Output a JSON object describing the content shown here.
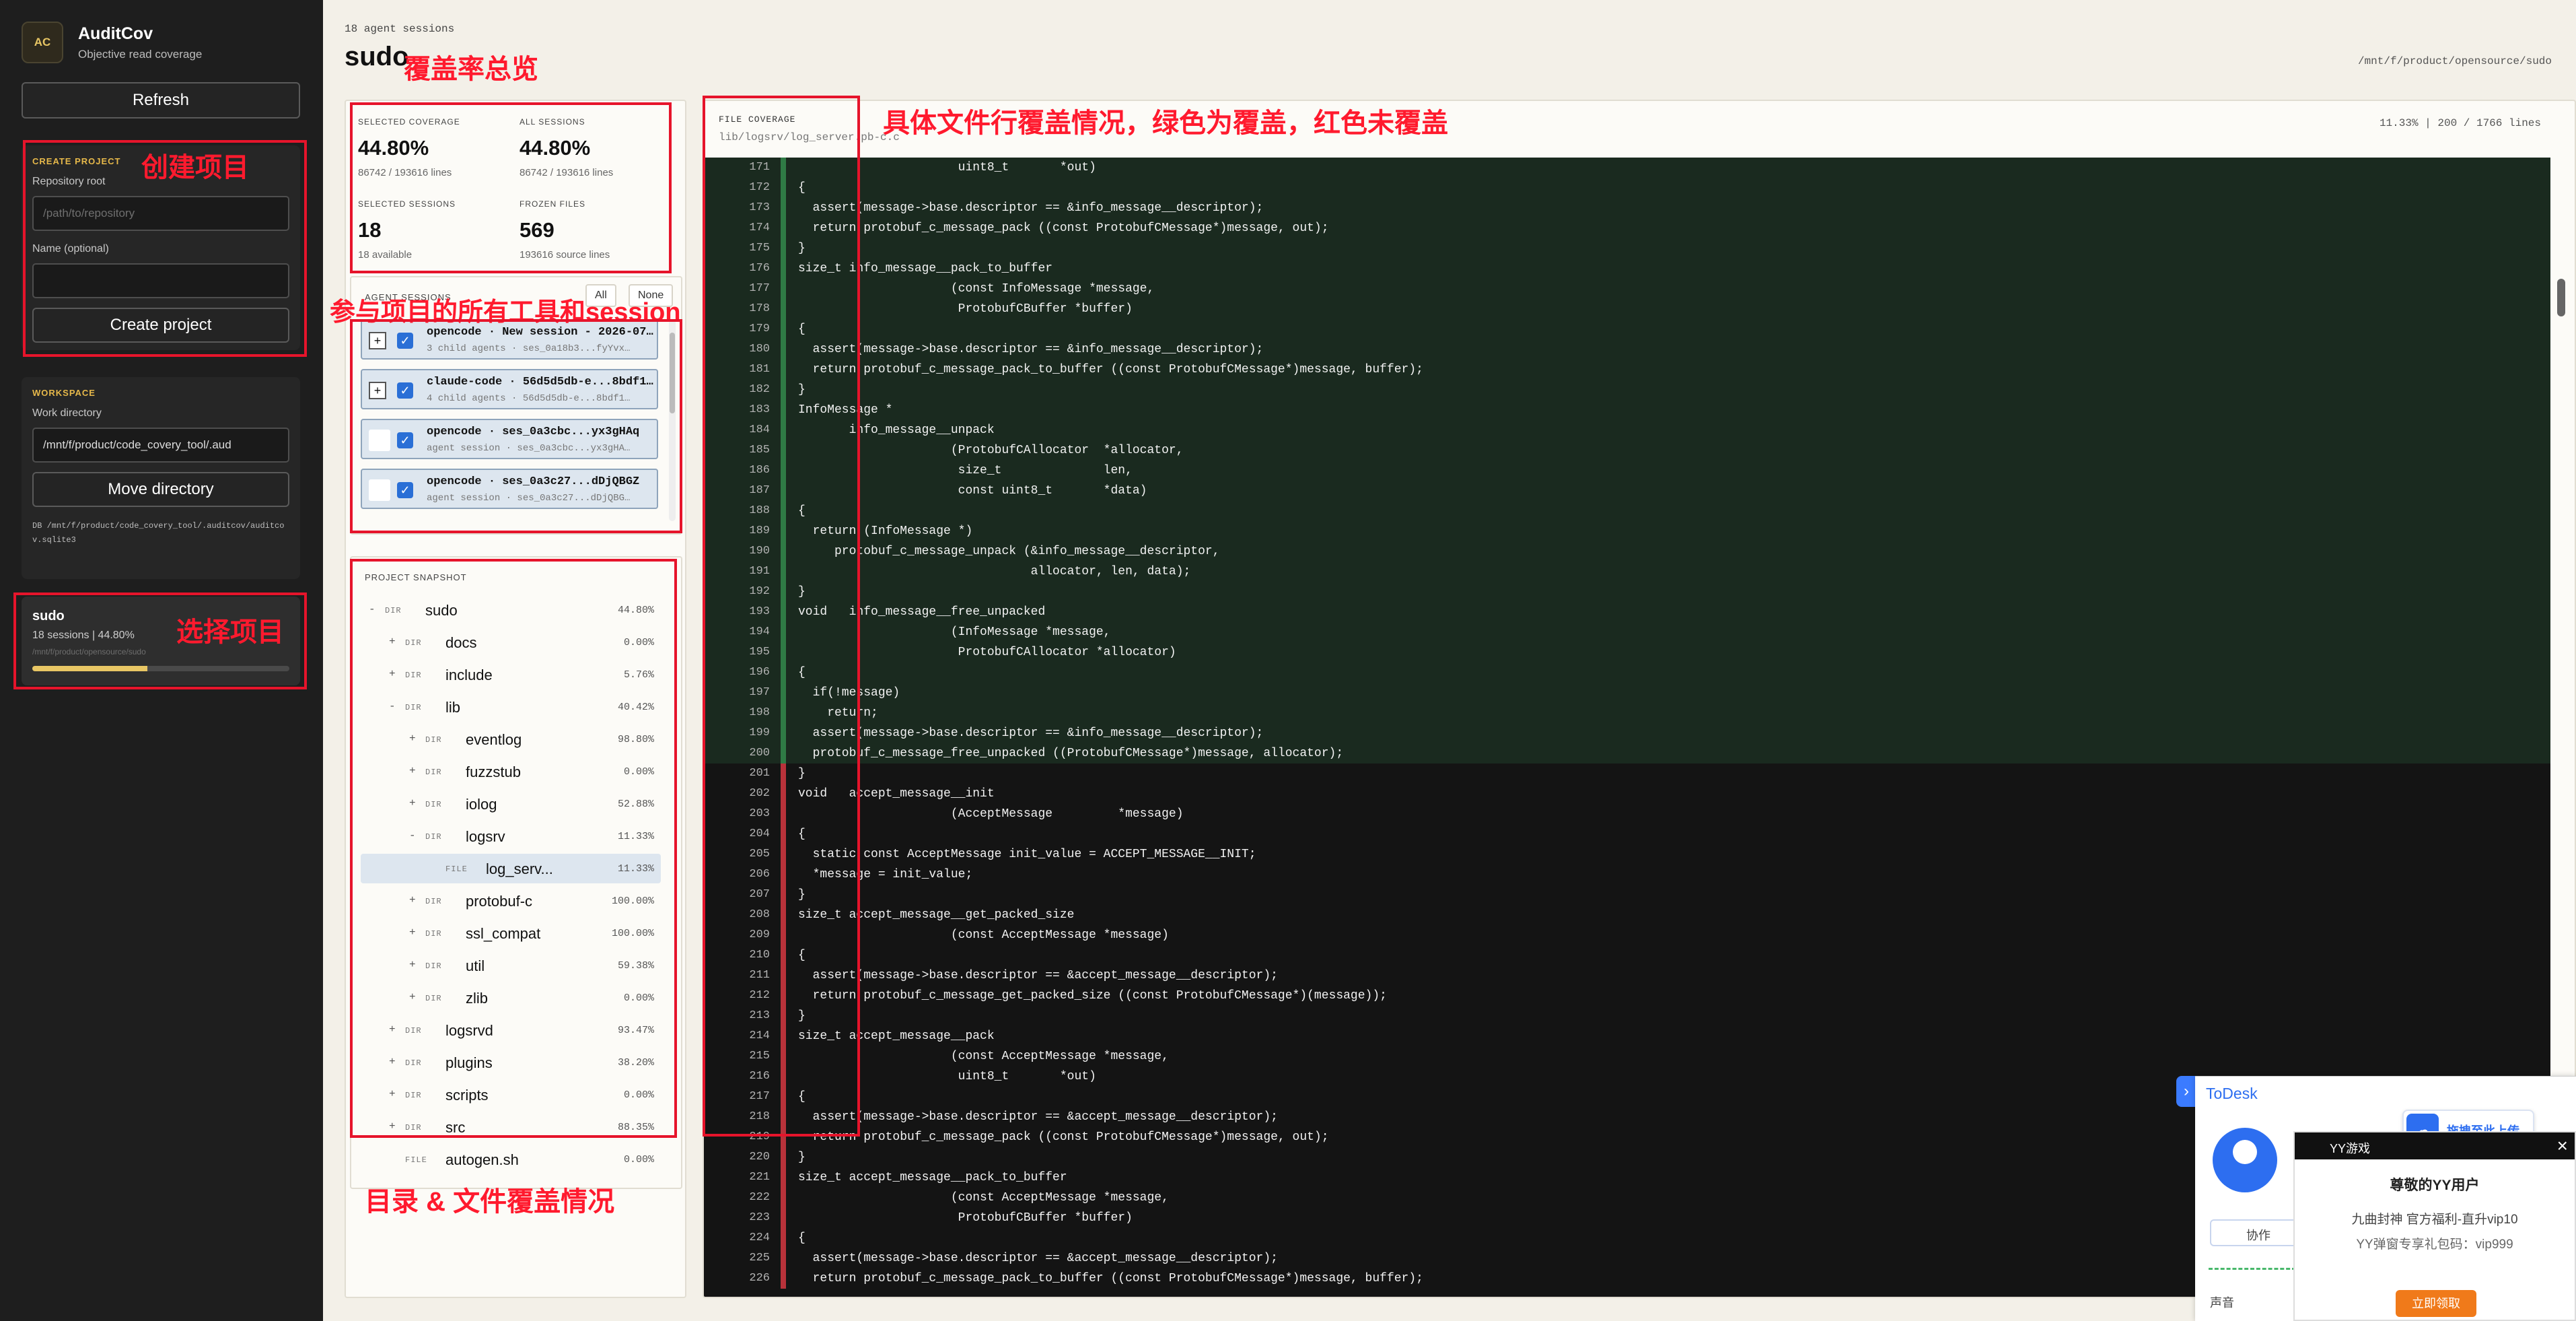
{
  "app": {
    "logo": "AC",
    "name": "AuditCov",
    "subtitle": "Objective read coverage",
    "refresh_label": "Refresh"
  },
  "create_project": {
    "heading": "CREATE PROJECT",
    "repo_label": "Repository root",
    "repo_placeholder": "/path/to/repository",
    "name_label": "Name (optional)",
    "name_value": "",
    "button": "Create project"
  },
  "workspace": {
    "heading": "WORKSPACE",
    "dir_label": "Work directory",
    "dir_value": "/mnt/f/product/code_covery_tool/.aud",
    "button": "Move directory",
    "db_text": "DB /mnt/f/product/code_covery_tool/.auditcov/auditcov.sqlite3"
  },
  "project_item": {
    "name": "sudo",
    "meta": "18 sessions | 44.80%",
    "path": "/mnt/f/product/opensource/sudo",
    "coverage_fraction": 0.448
  },
  "header": {
    "crumb": "18 agent sessions",
    "title": "sudo",
    "path": "/mnt/f/product/opensource/sudo"
  },
  "stats": [
    {
      "label": "SELECTED COVERAGE",
      "value": "44.80%",
      "sub": "86742 / 193616 lines"
    },
    {
      "label": "ALL SESSIONS",
      "value": "44.80%",
      "sub": "86742 / 193616 lines"
    },
    {
      "label": "SELECTED SESSIONS",
      "value": "18",
      "sub": "18 available"
    },
    {
      "label": "FROZEN FILES",
      "value": "569",
      "sub": "193616 source lines"
    }
  ],
  "sessions": {
    "heading": "AGENT SESSIONS",
    "all_label": "All",
    "none_label": "None",
    "items": [
      {
        "expand": "+",
        "title": "opencode · New session - 2026-07…",
        "sub": "3 child agents · ses_0a18b3...fyYvx…"
      },
      {
        "expand": "+",
        "title": "claude-code · 56d5d5db-e...8bdf1…",
        "sub": "4 child agents · 56d5d5db-e...8bdf1…"
      },
      {
        "expand": "",
        "title": "opencode · ses_0a3cbc...yx3gHAq",
        "sub": "agent session · ses_0a3cbc...yx3gHA…"
      },
      {
        "expand": "",
        "title": "opencode · ses_0a3c27...dDjQBGZ",
        "sub": "agent session · ses_0a3c27...dDjQBG…"
      }
    ],
    "check_mark": "✓"
  },
  "snapshot": {
    "heading": "PROJECT SNAPSHOT",
    "rows": [
      {
        "toggle": "-",
        "kind": "DIR",
        "name": "sudo",
        "pct": "44.80%",
        "depth": 0,
        "selected": false
      },
      {
        "toggle": "+",
        "kind": "DIR",
        "name": "docs",
        "pct": "0.00%",
        "depth": 1,
        "selected": false
      },
      {
        "toggle": "+",
        "kind": "DIR",
        "name": "include",
        "pct": "5.76%",
        "depth": 1,
        "selected": false
      },
      {
        "toggle": "-",
        "kind": "DIR",
        "name": "lib",
        "pct": "40.42%",
        "depth": 1,
        "selected": false
      },
      {
        "toggle": "+",
        "kind": "DIR",
        "name": "eventlog",
        "pct": "98.80%",
        "depth": 2,
        "selected": false
      },
      {
        "toggle": "+",
        "kind": "DIR",
        "name": "fuzzstub",
        "pct": "0.00%",
        "depth": 2,
        "selected": false
      },
      {
        "toggle": "+",
        "kind": "DIR",
        "name": "iolog",
        "pct": "52.88%",
        "depth": 2,
        "selected": false
      },
      {
        "toggle": "-",
        "kind": "DIR",
        "name": "logsrv",
        "pct": "11.33%",
        "depth": 2,
        "selected": false
      },
      {
        "toggle": "",
        "kind": "FILE",
        "name": "log_serv...",
        "pct": "11.33%",
        "depth": 3,
        "selected": true
      },
      {
        "toggle": "+",
        "kind": "DIR",
        "name": "protobuf-c",
        "pct": "100.00%",
        "depth": 2,
        "selected": false
      },
      {
        "toggle": "+",
        "kind": "DIR",
        "name": "ssl_compat",
        "pct": "100.00%",
        "depth": 2,
        "selected": false
      },
      {
        "toggle": "+",
        "kind": "DIR",
        "name": "util",
        "pct": "59.38%",
        "depth": 2,
        "selected": false
      },
      {
        "toggle": "+",
        "kind": "DIR",
        "name": "zlib",
        "pct": "0.00%",
        "depth": 2,
        "selected": false
      },
      {
        "toggle": "+",
        "kind": "DIR",
        "name": "logsrvd",
        "pct": "93.47%",
        "depth": 1,
        "selected": false
      },
      {
        "toggle": "+",
        "kind": "DIR",
        "name": "plugins",
        "pct": "38.20%",
        "depth": 1,
        "selected": false
      },
      {
        "toggle": "+",
        "kind": "DIR",
        "name": "scripts",
        "pct": "0.00%",
        "depth": 1,
        "selected": false
      },
      {
        "toggle": "+",
        "kind": "DIR",
        "name": "src",
        "pct": "88.35%",
        "depth": 1,
        "selected": false
      },
      {
        "toggle": "",
        "kind": "FILE",
        "name": "autogen.sh",
        "pct": "0.00%",
        "depth": 1,
        "selected": false
      }
    ]
  },
  "file_coverage": {
    "heading": "FILE COVERAGE",
    "file": "lib/logsrv/log_server.pb-c.c",
    "meta": "11.33% | 200 / 1766 lines",
    "lines": [
      {
        "n": "171",
        "s": "c",
        "t": "                      uint8_t       *out)"
      },
      {
        "n": "172",
        "s": "c",
        "t": "{"
      },
      {
        "n": "173",
        "s": "c",
        "t": "  assert(message->base.descriptor == &info_message__descriptor);"
      },
      {
        "n": "174",
        "s": "c",
        "t": "  return protobuf_c_message_pack ((const ProtobufCMessage*)message, out);"
      },
      {
        "n": "175",
        "s": "c",
        "t": "}"
      },
      {
        "n": "176",
        "s": "c",
        "t": "size_t info_message__pack_to_buffer"
      },
      {
        "n": "177",
        "s": "c",
        "t": "                     (const InfoMessage *message,"
      },
      {
        "n": "178",
        "s": "c",
        "t": "                      ProtobufCBuffer *buffer)"
      },
      {
        "n": "179",
        "s": "c",
        "t": "{"
      },
      {
        "n": "180",
        "s": "c",
        "t": "  assert(message->base.descriptor == &info_message__descriptor);"
      },
      {
        "n": "181",
        "s": "c",
        "t": "  return protobuf_c_message_pack_to_buffer ((const ProtobufCMessage*)message, buffer);"
      },
      {
        "n": "182",
        "s": "c",
        "t": "}"
      },
      {
        "n": "183",
        "s": "c",
        "t": "InfoMessage *"
      },
      {
        "n": "184",
        "s": "c",
        "t": "       info_message__unpack"
      },
      {
        "n": "185",
        "s": "c",
        "t": "                     (ProtobufCAllocator  *allocator,"
      },
      {
        "n": "186",
        "s": "c",
        "t": "                      size_t              len,"
      },
      {
        "n": "187",
        "s": "c",
        "t": "                      const uint8_t       *data)"
      },
      {
        "n": "188",
        "s": "c",
        "t": "{"
      },
      {
        "n": "189",
        "s": "c",
        "t": "  return (InfoMessage *)"
      },
      {
        "n": "190",
        "s": "c",
        "t": "     protobuf_c_message_unpack (&info_message__descriptor,"
      },
      {
        "n": "191",
        "s": "c",
        "t": "                                allocator, len, data);"
      },
      {
        "n": "192",
        "s": "c",
        "t": "}"
      },
      {
        "n": "193",
        "s": "c",
        "t": "void   info_message__free_unpacked"
      },
      {
        "n": "194",
        "s": "c",
        "t": "                     (InfoMessage *message,"
      },
      {
        "n": "195",
        "s": "c",
        "t": "                      ProtobufCAllocator *allocator)"
      },
      {
        "n": "196",
        "s": "c",
        "t": "{"
      },
      {
        "n": "197",
        "s": "c",
        "t": "  if(!message)"
      },
      {
        "n": "198",
        "s": "c",
        "t": "    return;"
      },
      {
        "n": "199",
        "s": "c",
        "t": "  assert(message->base.descriptor == &info_message__descriptor);"
      },
      {
        "n": "200",
        "s": "c",
        "t": "  protobuf_c_message_free_unpacked ((ProtobufCMessage*)message, allocator);"
      },
      {
        "n": "201",
        "s": "u",
        "t": "}"
      },
      {
        "n": "202",
        "s": "u",
        "t": "void   accept_message__init"
      },
      {
        "n": "203",
        "s": "u",
        "t": "                     (AcceptMessage         *message)"
      },
      {
        "n": "204",
        "s": "u",
        "t": "{"
      },
      {
        "n": "205",
        "s": "u",
        "t": "  static const AcceptMessage init_value = ACCEPT_MESSAGE__INIT;"
      },
      {
        "n": "206",
        "s": "u",
        "t": "  *message = init_value;"
      },
      {
        "n": "207",
        "s": "u",
        "t": "}"
      },
      {
        "n": "208",
        "s": "u",
        "t": "size_t accept_message__get_packed_size"
      },
      {
        "n": "209",
        "s": "u",
        "t": "                     (const AcceptMessage *message)"
      },
      {
        "n": "210",
        "s": "u",
        "t": "{"
      },
      {
        "n": "211",
        "s": "u",
        "t": "  assert(message->base.descriptor == &accept_message__descriptor);"
      },
      {
        "n": "212",
        "s": "u",
        "t": "  return protobuf_c_message_get_packed_size ((const ProtobufCMessage*)(message));"
      },
      {
        "n": "213",
        "s": "u",
        "t": "}"
      },
      {
        "n": "214",
        "s": "u",
        "t": "size_t accept_message__pack"
      },
      {
        "n": "215",
        "s": "u",
        "t": "                     (const AcceptMessage *message,"
      },
      {
        "n": "216",
        "s": "u",
        "t": "                      uint8_t       *out)"
      },
      {
        "n": "217",
        "s": "u",
        "t": "{"
      },
      {
        "n": "218",
        "s": "u",
        "t": "  assert(message->base.descriptor == &accept_message__descriptor);"
      },
      {
        "n": "219",
        "s": "u",
        "t": "  return protobuf_c_message_pack ((const ProtobufCMessage*)message, out);"
      },
      {
        "n": "220",
        "s": "u",
        "t": "}"
      },
      {
        "n": "221",
        "s": "u",
        "t": "size_t accept_message__pack_to_buffer"
      },
      {
        "n": "222",
        "s": "u",
        "t": "                     (const AcceptMessage *message,"
      },
      {
        "n": "223",
        "s": "u",
        "t": "                      ProtobufCBuffer *buffer)"
      },
      {
        "n": "224",
        "s": "u",
        "t": "{"
      },
      {
        "n": "225",
        "s": "u",
        "t": "  assert(message->base.descriptor == &accept_message__descriptor);"
      },
      {
        "n": "226",
        "s": "u",
        "t": "  return protobuf_c_message_pack_to_buffer ((const ProtobufCMessage*)message, buffer);"
      }
    ]
  },
  "annotations": {
    "create_project": "创建项目",
    "select_project": "选择项目",
    "coverage_overview": "覆盖率总览",
    "sessions": "参与项目的所有工具和session",
    "tree": "目录 & 文件覆盖情况",
    "file_coverage": "具体文件行覆盖情况，绿色为覆盖，红色未覆盖"
  },
  "todesk": {
    "title": "ToDesk",
    "collab": "协作",
    "sound": "声音",
    "arrow": "›"
  },
  "upload": {
    "label": "拖拽至此上传",
    "icon": "cloud-icon"
  },
  "yy": {
    "title": "YY游戏",
    "close": "×",
    "greeting": "尊敬的YY用户",
    "line1": "九曲封神 官方福利-直升vip10",
    "line2": "YY弹窗专享礼包码：vip999",
    "button": "立即领取"
  },
  "colors": {
    "covered": "#2f7a45",
    "uncovered": "#b8323a",
    "accent": "#e8c664",
    "annotation": "#e6142b"
  }
}
